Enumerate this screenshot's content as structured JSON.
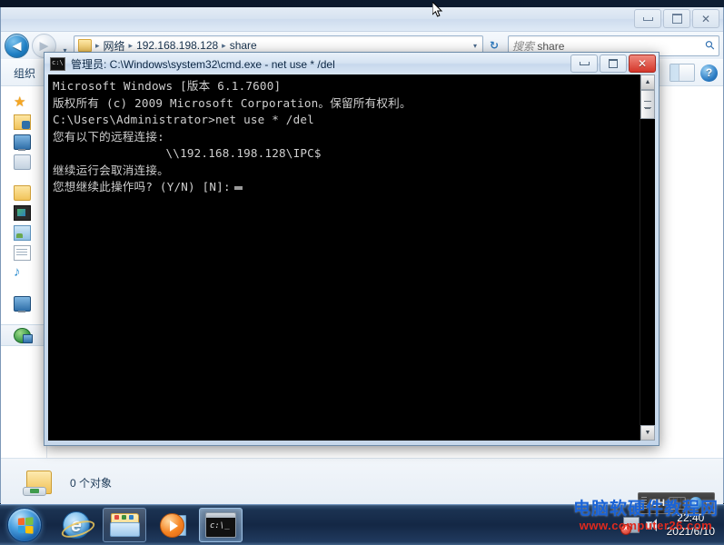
{
  "explorer": {
    "window_buttons": {
      "minimize": "–",
      "maximize": "□",
      "close": "✕"
    },
    "nav": {
      "back": "◀",
      "forward": "▶",
      "dropdown": "▾"
    },
    "address": {
      "crumbs": [
        "网络",
        "192.168.198.128",
        "share"
      ],
      "separator": "▸",
      "caret": "▾",
      "refresh": "↻"
    },
    "search": {
      "prefix": "搜索 ",
      "value": "share",
      "icon": "search-icon"
    },
    "toolbar": {
      "organize": "组织",
      "view_label": "view-toggle",
      "help": "?"
    },
    "sidebar": {
      "items": [
        {
          "name": "favorites",
          "icon": "star-icon"
        },
        {
          "name": "downloads",
          "icon": "download-folder-icon"
        },
        {
          "name": "desktop",
          "icon": "desktop-icon"
        },
        {
          "name": "recent-places",
          "icon": "recent-places-icon"
        },
        {
          "name": "libraries",
          "icon": "library-folder-icon"
        },
        {
          "name": "videos",
          "icon": "video-icon"
        },
        {
          "name": "pictures",
          "icon": "picture-icon"
        },
        {
          "name": "documents",
          "icon": "document-icon"
        },
        {
          "name": "music",
          "icon": "music-note-icon"
        },
        {
          "name": "computer",
          "icon": "computer-icon"
        },
        {
          "name": "network",
          "icon": "network-icon",
          "selected": true
        }
      ]
    },
    "status": {
      "text": "0 个对象",
      "icon": "network-folder-icon"
    }
  },
  "cmd": {
    "title": "管理员: C:\\Windows\\system32\\cmd.exe - net  use * /del",
    "icon": "console-icon",
    "buttons": {
      "minimize": "–",
      "maximize": "□",
      "close": "✕"
    },
    "scrollbar": {
      "up": "▲",
      "down": "▼"
    },
    "lines": [
      "Microsoft Windows [版本 6.1.7600]",
      "版权所有 (c) 2009 Microsoft Corporation。保留所有权利。",
      "",
      "C:\\Users\\Administrator>net use * /del",
      "您有以下的远程连接:",
      "",
      "                \\\\192.168.198.128\\IPC$",
      "继续运行会取消连接。",
      "",
      "您想继续此操作吗? (Y/N) [N]:"
    ]
  },
  "taskbar": {
    "start": "start-orb",
    "items": [
      {
        "name": "internet-explorer",
        "pinned": false,
        "active": false
      },
      {
        "name": "windows-explorer",
        "pinned": true,
        "active": false
      },
      {
        "name": "windows-media-player",
        "pinned": false,
        "active": false
      },
      {
        "name": "command-prompt",
        "pinned": false,
        "active": true,
        "label": "c:\\_"
      }
    ],
    "language_bar": {
      "lang": "CH",
      "keyboard": "keyboard-icon",
      "help": "?",
      "caret": "▾"
    },
    "tray": {
      "network_status": "×",
      "volume": "volume-icon"
    },
    "clock": {
      "time": "22:40",
      "date": "2021/6/10"
    }
  },
  "watermark": {
    "line1": "电脑软硬件教程网",
    "line2": "www.computer26.com"
  }
}
